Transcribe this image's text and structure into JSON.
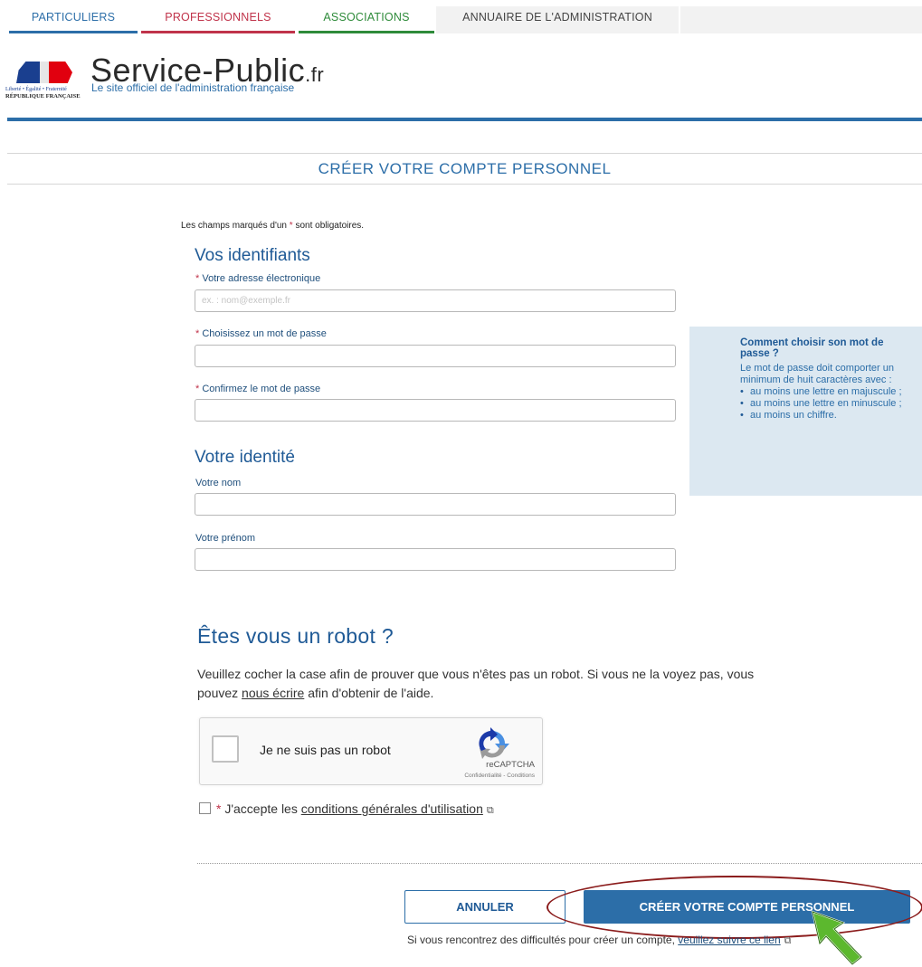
{
  "topnav": {
    "tabs": [
      {
        "label": "PARTICULIERS",
        "color": "#2c6ea8"
      },
      {
        "label": "PROFESSIONNELS",
        "color": "#c0334a"
      },
      {
        "label": "ASSOCIATIONS",
        "color": "#2e8b3a"
      },
      {
        "label": "ANNUAIRE DE L'ADMINISTRATION",
        "color": "#444444"
      }
    ]
  },
  "header": {
    "site_name": "Service-Public",
    "site_tld": ".fr",
    "subtitle": "Le site officiel de l'administration française",
    "logo_motto": "Liberté • Égalité • Fraternité",
    "logo_country": "RÉPUBLIQUE FRANÇAISE",
    "rule_color": "#2c6ea8"
  },
  "page": {
    "title": "CRÉER VOTRE COMPTE PERSONNEL"
  },
  "form": {
    "required_note_before": "Les champs marqués d'un ",
    "required_star": "*",
    "required_note_after": " sont obligatoires.",
    "section_identifiants": "Vos identifiants",
    "email_label": "Votre adresse électronique",
    "email_placeholder": "ex. : nom@exemple.fr",
    "email_value": "",
    "password_label": "Choisissez un mot de passe",
    "password_confirm_label": "Confirmez le mot de passe",
    "section_identite": "Votre identité",
    "nom_label": "Votre nom",
    "prenom_label": "Votre prénom"
  },
  "password_help": {
    "title": "Comment choisir son mot de passe ?",
    "intro": "Le mot de passe doit comporter un minimum de huit caractères avec :",
    "rules": [
      "au moins une lettre en majuscule ;",
      "au moins une lettre en minuscule ;",
      "au moins un chiffre."
    ]
  },
  "robot": {
    "title": "Êtes vous un robot ?",
    "text_before": "Veuillez cocher la case afin de prouver que vous n'êtes pas un robot. Si vous ne la voyez pas, vous pouvez ",
    "link": "nous écrire",
    "text_after": " afin d'obtenir de l'aide.",
    "recaptcha_label": "Je ne suis pas un robot",
    "recaptcha_brand": "reCAPTCHA",
    "recaptcha_terms": "Confidentialité - Conditions",
    "recaptcha_checked": false
  },
  "cgu": {
    "star": "*",
    "text": "J'accepte les ",
    "link": "conditions générales d'utilisation",
    "checked": false
  },
  "actions": {
    "cancel_label": "ANNULER",
    "create_label": "CRÉER VOTRE COMPTE PERSONNEL",
    "help_text": "Si vous rencontrez des difficultés pour créer un compte, ",
    "help_link": "veuillez suivre ce lien"
  },
  "colors": {
    "brand_blue": "#2c6ea8",
    "dark_blue": "#1f5a96",
    "required_red": "#c0334a",
    "annotation_red": "#8b1c1c",
    "cursor_green": "#5cb82e"
  }
}
